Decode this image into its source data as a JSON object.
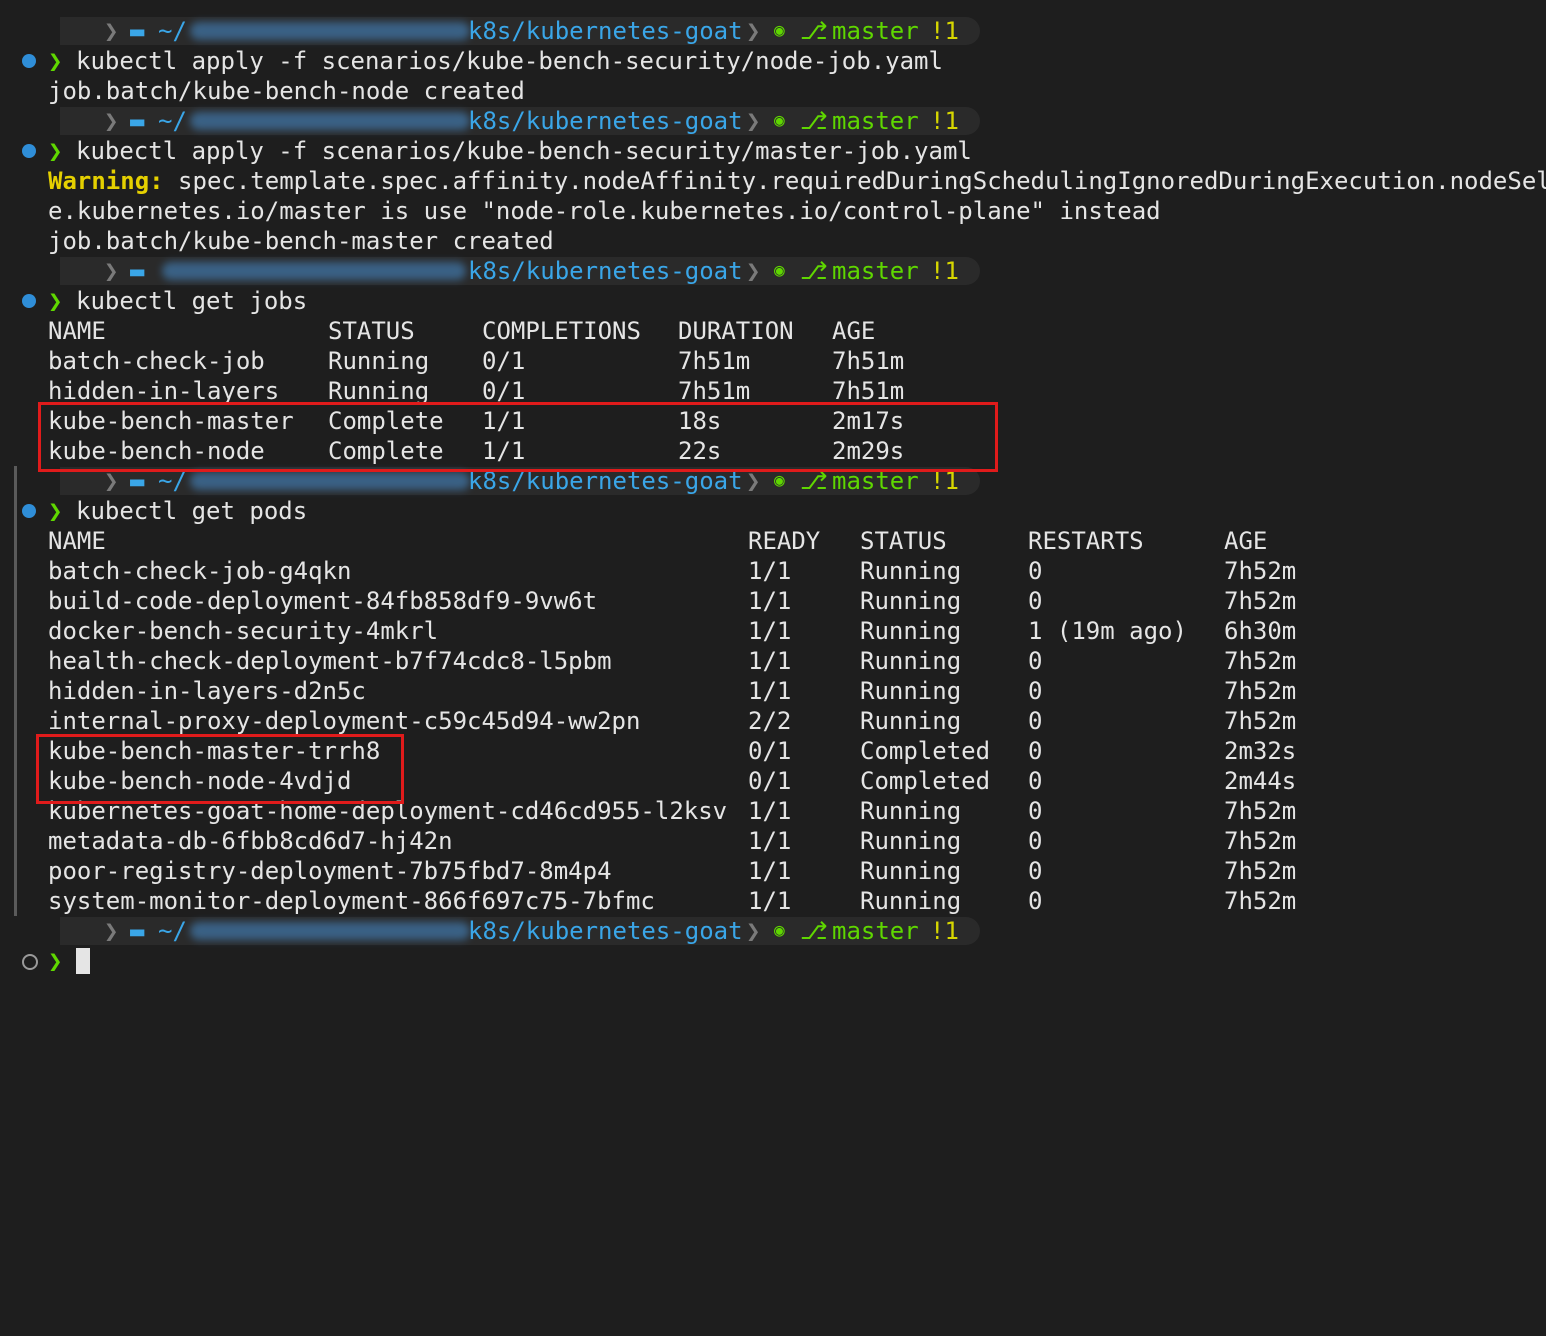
{
  "prompt": {
    "home": "~/",
    "repo": "k8s/kubernetes-goat",
    "branch": "master",
    "dirty": "!1",
    "symbol": "❯",
    "apple_glyph": "",
    "git_icon": "🐱",
    "branch_icon": "⎇",
    "folder_icon": "folder-icon"
  },
  "commands": {
    "apply_node": "kubectl apply -f scenarios/kube-bench-security/node-job.yaml",
    "apply_node_out": "job.batch/kube-bench-node created",
    "apply_master": "kubectl apply -f scenarios/kube-bench-security/master-job.yaml",
    "warning_label": "Warning:",
    "warning_text": " spec.template.spec.affinity.nodeAffinity.requiredDuringSchedulingIgnoredDuringExecution.nodeSelect",
    "warning_cont": "e.kubernetes.io/master is use \"node-role.kubernetes.io/control-plane\" instead",
    "apply_master_out": "job.batch/kube-bench-master created",
    "get_jobs": "kubectl get jobs",
    "get_pods": "kubectl get pods"
  },
  "jobs": {
    "headers": [
      "NAME",
      "STATUS",
      "COMPLETIONS",
      "DURATION",
      "AGE"
    ],
    "rows": [
      [
        "batch-check-job",
        "Running",
        "0/1",
        "7h51m",
        "7h51m"
      ],
      [
        "hidden-in-layers",
        "Running",
        "0/1",
        "7h51m",
        "7h51m"
      ],
      [
        "kube-bench-master",
        "Complete",
        "1/1",
        "18s",
        "2m17s"
      ],
      [
        "kube-bench-node",
        "Complete",
        "1/1",
        "22s",
        "2m29s"
      ]
    ]
  },
  "pods": {
    "headers": [
      "NAME",
      "READY",
      "STATUS",
      "RESTARTS",
      "AGE"
    ],
    "rows": [
      [
        "batch-check-job-g4qkn",
        "1/1",
        "Running",
        "0",
        "7h52m"
      ],
      [
        "build-code-deployment-84fb858df9-9vw6t",
        "1/1",
        "Running",
        "0",
        "7h52m"
      ],
      [
        "docker-bench-security-4mkrl",
        "1/1",
        "Running",
        "1 (19m ago)",
        "6h30m"
      ],
      [
        "health-check-deployment-b7f74cdc8-l5pbm",
        "1/1",
        "Running",
        "0",
        "7h52m"
      ],
      [
        "hidden-in-layers-d2n5c",
        "1/1",
        "Running",
        "0",
        "7h52m"
      ],
      [
        "internal-proxy-deployment-c59c45d94-ww2pn",
        "2/2",
        "Running",
        "0",
        "7h52m"
      ],
      [
        "kube-bench-master-trrh8",
        "0/1",
        "Completed",
        "0",
        "2m32s"
      ],
      [
        "kube-bench-node-4vdjd",
        "0/1",
        "Completed",
        "0",
        "2m44s"
      ],
      [
        "kubernetes-goat-home-deployment-cd46cd955-l2ksv",
        "1/1",
        "Running",
        "0",
        "7h52m"
      ],
      [
        "metadata-db-6fbb8cd6d7-hj42n",
        "1/1",
        "Running",
        "0",
        "7h52m"
      ],
      [
        "poor-registry-deployment-7b75fbd7-8m4p4",
        "1/1",
        "Running",
        "0",
        "7h52m"
      ],
      [
        "system-monitor-deployment-866f697c75-7bfmc",
        "1/1",
        "Running",
        "0",
        "7h52m"
      ]
    ]
  },
  "colors": {
    "background": "#1e1e1e",
    "prompt_blue": "#3aa6e8",
    "prompt_green": "#5fd700",
    "dirty_yellow": "#d7d700",
    "warning_yellow": "#e5d000",
    "highlight_red": "#e01b1b"
  }
}
